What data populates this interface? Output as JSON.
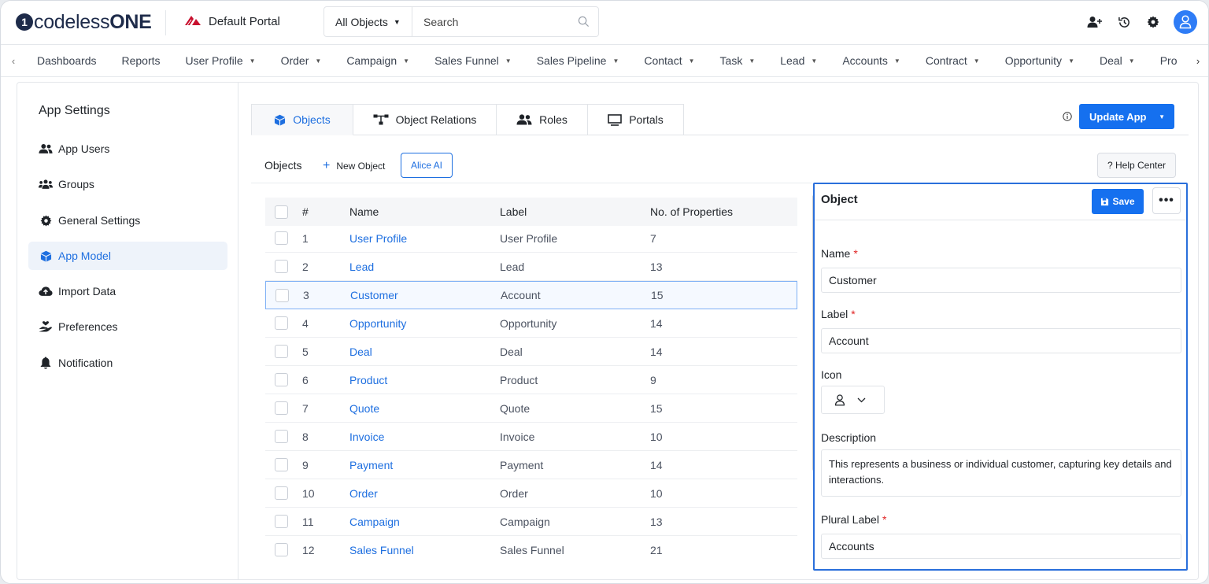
{
  "header": {
    "logo_mark": "1",
    "logo_text_a": "codeless",
    "logo_text_b": "ONE",
    "portal_name": "Default Portal",
    "object_filter": "All Objects",
    "search_placeholder": "Search",
    "avatar_color": "#2e7cf6"
  },
  "nav": {
    "items": [
      "Dashboards",
      "Reports",
      "User Profile",
      "Order",
      "Campaign",
      "Sales Funnel",
      "Sales Pipeline",
      "Contact",
      "Task",
      "Lead",
      "Accounts",
      "Contract",
      "Opportunity",
      "Deal",
      "Pro"
    ],
    "dropdown": [
      false,
      false,
      true,
      true,
      true,
      true,
      true,
      true,
      true,
      true,
      true,
      true,
      true,
      true,
      false
    ]
  },
  "sidebar": {
    "title": "App Settings",
    "items": [
      {
        "label": "App Users",
        "icon": "users-icon"
      },
      {
        "label": "Groups",
        "icon": "groups-icon"
      },
      {
        "label": "General Settings",
        "icon": "gear-icon"
      },
      {
        "label": "App Model",
        "icon": "cube-icon"
      },
      {
        "label": "Import Data",
        "icon": "cloud-upload-icon"
      },
      {
        "label": "Preferences",
        "icon": "hand-heart-icon"
      },
      {
        "label": "Notification",
        "icon": "bell-icon"
      }
    ],
    "active_index": 3
  },
  "tabs": [
    {
      "label": "Objects",
      "icon": "cube-icon",
      "active": true
    },
    {
      "label": "Object Relations",
      "icon": "relations-icon",
      "active": false
    },
    {
      "label": "Roles",
      "icon": "users-icon",
      "active": false
    },
    {
      "label": "Portals",
      "icon": "monitor-icon",
      "active": false
    }
  ],
  "actions": {
    "update_app": "Update App",
    "objects_label": "Objects",
    "new_object": "New Object",
    "alice_ai": "Alice AI",
    "help_center": "? Help Center"
  },
  "table": {
    "columns": [
      "#",
      "Name",
      "Label",
      "No. of Properties"
    ],
    "selected_row": 2,
    "rows": [
      {
        "num": "1",
        "name": "User Profile",
        "label": "User Profile",
        "props": "7"
      },
      {
        "num": "2",
        "name": "Lead",
        "label": "Lead",
        "props": "13"
      },
      {
        "num": "3",
        "name": "Customer",
        "label": "Account",
        "props": "15"
      },
      {
        "num": "4",
        "name": "Opportunity",
        "label": "Opportunity",
        "props": "14"
      },
      {
        "num": "5",
        "name": "Deal",
        "label": "Deal",
        "props": "14"
      },
      {
        "num": "6",
        "name": "Product",
        "label": "Product",
        "props": "9"
      },
      {
        "num": "7",
        "name": "Quote",
        "label": "Quote",
        "props": "15"
      },
      {
        "num": "8",
        "name": "Invoice",
        "label": "Invoice",
        "props": "10"
      },
      {
        "num": "9",
        "name": "Payment",
        "label": "Payment",
        "props": "14"
      },
      {
        "num": "10",
        "name": "Order",
        "label": "Order",
        "props": "10"
      },
      {
        "num": "11",
        "name": "Campaign",
        "label": "Campaign",
        "props": "13"
      },
      {
        "num": "12",
        "name": "Sales Funnel",
        "label": "Sales Funnel",
        "props": "21"
      }
    ]
  },
  "detail": {
    "title": "Object",
    "save_label": "Save",
    "more_label": "•••",
    "name_label": "Name",
    "name_value": "Customer",
    "label_label": "Label",
    "label_value": "Account",
    "icon_label": "Icon",
    "icon_value": "user-icon",
    "description_label": "Description",
    "description_value": "This represents a business or individual customer, capturing key details and interactions.",
    "plural_label": "Plural Label",
    "plural_value": "Accounts",
    "required_mark": "*"
  },
  "colors": {
    "accent": "#1570ef",
    "link": "#1e6fe0",
    "required": "#e02424"
  }
}
